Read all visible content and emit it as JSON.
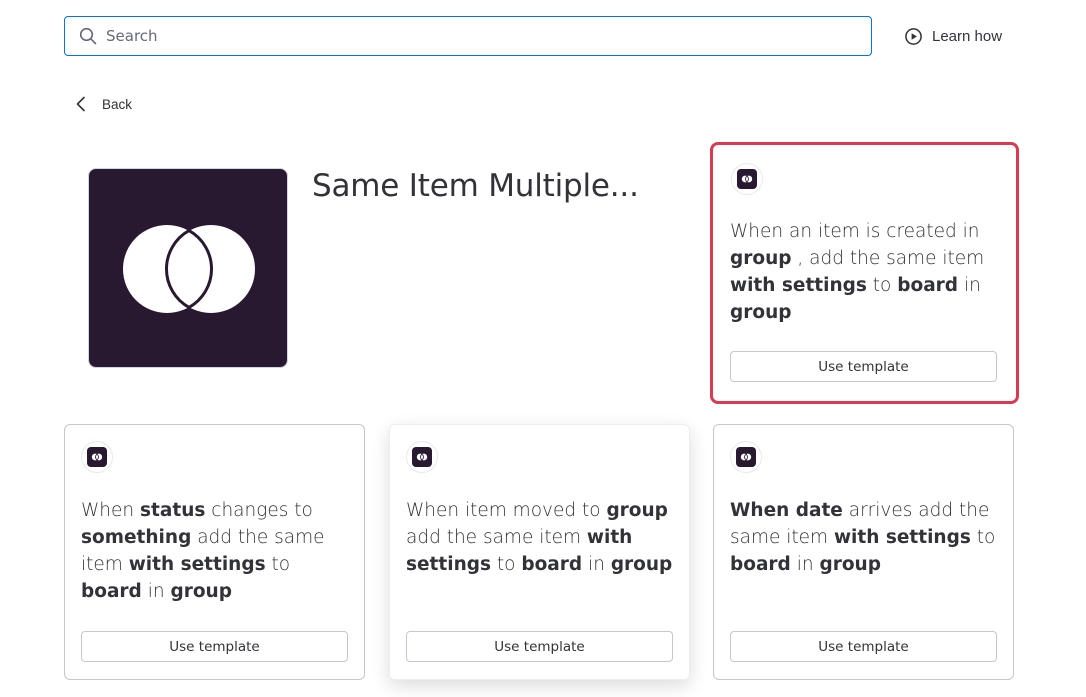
{
  "search": {
    "placeholder": "Search",
    "value": ""
  },
  "learn_how": {
    "label": "Learn how",
    "icon": "play-circle-icon"
  },
  "back": {
    "label": "Back",
    "icon": "chevron-left-icon"
  },
  "hero": {
    "title": "Same Item Multiple...",
    "icon": "interlocking-circles-icon",
    "bg_color": "#281930"
  },
  "colors": {
    "highlight_border": "#d83a52",
    "focus_border": "#0073ea"
  },
  "templates": [
    {
      "segments": [
        {
          "t": "When an item is created in ",
          "b": false
        },
        {
          "t": "group",
          "b": true
        },
        {
          "t": " , add the same item ",
          "b": false
        },
        {
          "t": "with settings",
          "b": true
        },
        {
          "t": " to ",
          "b": false
        },
        {
          "t": "board",
          "b": true
        },
        {
          "t": " in ",
          "b": false
        },
        {
          "t": "group",
          "b": true
        }
      ],
      "button": "Use template",
      "highlighted": true
    },
    {
      "segments": [
        {
          "t": "When ",
          "b": false
        },
        {
          "t": "status",
          "b": true
        },
        {
          "t": " changes to ",
          "b": false
        },
        {
          "t": "something",
          "b": true
        },
        {
          "t": " add the same item ",
          "b": false
        },
        {
          "t": "with settings",
          "b": true
        },
        {
          "t": " to ",
          "b": false
        },
        {
          "t": "board",
          "b": true
        },
        {
          "t": " in ",
          "b": false
        },
        {
          "t": "group",
          "b": true
        }
      ],
      "button": "Use template",
      "highlighted": false
    },
    {
      "segments": [
        {
          "t": "When item moved to ",
          "b": false
        },
        {
          "t": "group",
          "b": true
        },
        {
          "t": " add the same item ",
          "b": false
        },
        {
          "t": "with settings",
          "b": true
        },
        {
          "t": " to ",
          "b": false
        },
        {
          "t": "board",
          "b": true
        },
        {
          "t": " in ",
          "b": false
        },
        {
          "t": "group",
          "b": true
        }
      ],
      "button": "Use template",
      "highlighted": false
    },
    {
      "segments": [
        {
          "t": "When date",
          "b": true
        },
        {
          "t": " arrives add the same item ",
          "b": false
        },
        {
          "t": "with settings",
          "b": true
        },
        {
          "t": " to ",
          "b": false
        },
        {
          "t": "board",
          "b": true
        },
        {
          "t": " in ",
          "b": false
        },
        {
          "t": "group",
          "b": true
        }
      ],
      "button": "Use template",
      "highlighted": false
    }
  ]
}
